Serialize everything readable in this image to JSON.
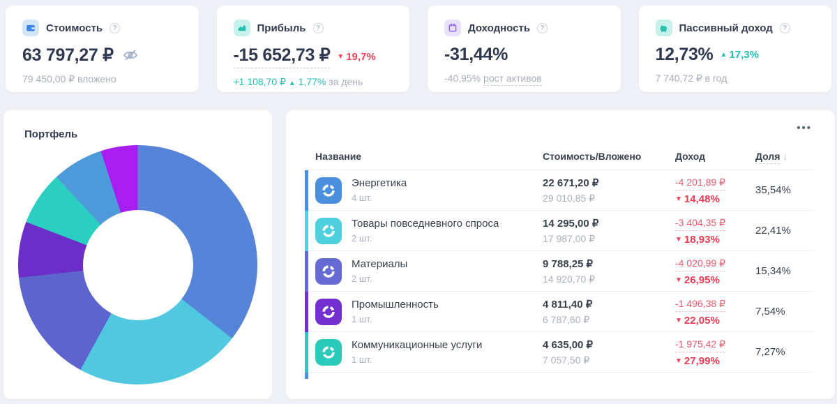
{
  "colors": {
    "page_bg": "#eef0f5",
    "panel_bg": "#ffffff",
    "text_dark": "#333d52",
    "text_gray": "#a8aebc",
    "negative_red": "#f0415a",
    "negative_red_light": "#f4586c",
    "positive_teal": "#1fbfb2",
    "divider": "#edeff3"
  },
  "icons": {
    "down_triangle": "▼",
    "up_triangle": "▲",
    "sort_down_arrow": "↓",
    "ellipsis": "•••",
    "help": "?"
  },
  "cards": [
    {
      "title": "Стоимость",
      "value": "63 797,27 ₽",
      "sub": "79 450,00 ₽ вложено",
      "icon": "wallet-icon",
      "icon_bg": "#d3e6fc",
      "icon_fg": "#3e87e8"
    },
    {
      "title": "Прибыль",
      "value": "-15 652,73 ₽",
      "delta_down": "19,7%",
      "day_change": "+1 108,70 ₽",
      "day_pct": "1,77%",
      "day_label": "за день",
      "icon": "profit-chart-icon",
      "icon_bg": "#c6f2ec",
      "icon_fg": "#1fbfb2"
    },
    {
      "title": "Доходность",
      "value": "-31,44%",
      "sub_value": "-40,95%",
      "sub_link": "рост активов",
      "icon": "calendar-icon",
      "icon_bg": "#e9e1fb",
      "icon_fg": "#8b5cf6"
    },
    {
      "title": "Пассивный доход",
      "value": "12,73%",
      "delta_up": "17,3%",
      "sub": "7 740,72 ₽ в год",
      "icon": "piggy-bank-icon",
      "icon_bg": "#c8f0ec",
      "icon_fg": "#2bbfae"
    }
  ],
  "portfolio": {
    "title": "Портфель"
  },
  "chart_data": {
    "type": "pie",
    "variant": "donut",
    "title": "Портфель",
    "unit": "%",
    "start_angle_deg": 0,
    "direction": "clockwise",
    "inner_hole_ratio": 0.46,
    "segments": [
      {
        "label": "Энергетика",
        "value": 35.54,
        "color": "#5584d8"
      },
      {
        "label": "Товары повседневного спроса",
        "value": 22.41,
        "color": "#4fc8e0"
      },
      {
        "label": "Материалы",
        "value": 15.34,
        "color": "#5e64ce"
      },
      {
        "label": "Промышленность",
        "value": 7.54,
        "color": "#6b2fc8"
      },
      {
        "label": "Коммуникационные услуги",
        "value": 7.27,
        "color": "#2bcfc2"
      },
      {
        "label": "",
        "value": 6.9,
        "color": "#4e9adb"
      },
      {
        "label": "",
        "value": 5.0,
        "color": "#a81ef0"
      }
    ]
  },
  "table": {
    "headers": {
      "name": "Название",
      "value": "Стоимость/Вложено",
      "income": "Доход",
      "share": "Доля"
    },
    "sort": {
      "column": "Доля",
      "direction": "desc"
    },
    "rows": [
      {
        "name": "Энергетика",
        "qty": "4 шт.",
        "value": "22 671,20 ₽",
        "invested": "29 010,85 ₽",
        "income": "-4 201,89 ₽",
        "income_pct": "14,48%",
        "share": "35,54%",
        "color": "#4a90dc"
      },
      {
        "name": "Товары повседневного спроса",
        "qty": "2 шт.",
        "value": "14 295,00 ₽",
        "invested": "17 987,00 ₽",
        "income": "-3 404,35 ₽",
        "income_pct": "18,93%",
        "share": "22,41%",
        "color": "#4fd0de"
      },
      {
        "name": "Материалы",
        "qty": "2 шт.",
        "value": "9 788,25 ₽",
        "invested": "14 920,70 ₽",
        "income": "-4 020,99 ₽",
        "income_pct": "26,95%",
        "share": "15,34%",
        "color": "#666bd4"
      },
      {
        "name": "Промышленность",
        "qty": "1 шт.",
        "value": "4 811,40 ₽",
        "invested": "6 787,60 ₽",
        "income": "-1 496,38 ₽",
        "income_pct": "22,05%",
        "share": "7,54%",
        "color": "#742fd0"
      },
      {
        "name": "Коммуникационные услуги",
        "qty": "1 шт.",
        "value": "4 635,00 ₽",
        "invested": "7 057,50 ₽",
        "income": "-1 975,42 ₽",
        "income_pct": "27,99%",
        "share": "7,27%",
        "color": "#2bcbbb"
      }
    ],
    "next_row_bar_color": "#4a90dc"
  }
}
